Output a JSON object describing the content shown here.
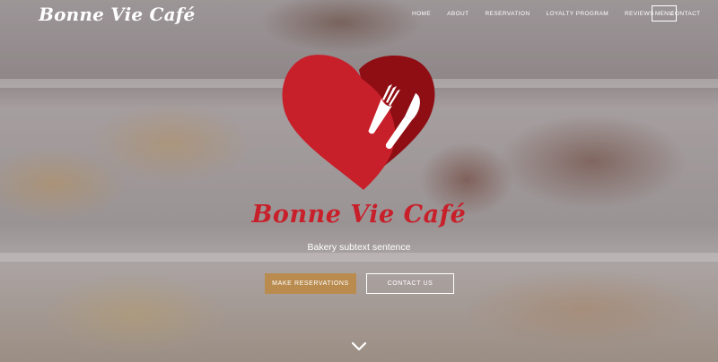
{
  "brand": {
    "name": "Bonne Vie Café"
  },
  "nav": {
    "items": [
      {
        "label": "HOME"
      },
      {
        "label": "ABOUT"
      },
      {
        "label": "RESERVATION"
      },
      {
        "label": "LOYALTY PROGRAM"
      },
      {
        "label": "REVIEWS"
      },
      {
        "label": "CONTACT"
      }
    ],
    "menu_label": "MENU"
  },
  "hero": {
    "title": "Bonne Vie Café",
    "subtext": "Bakery subtext sentence",
    "primary_button": "MAKE RESERVATIONS",
    "secondary_button": "CONTACT US",
    "logo_icon": "heart-fork-knife-icon",
    "scroll_icon": "chevron-down-icon"
  },
  "colors": {
    "accent_red": "#c8202a",
    "dark_red": "#8e0e14",
    "button_gold": "#b98b4e",
    "text_white": "#ffffff"
  }
}
